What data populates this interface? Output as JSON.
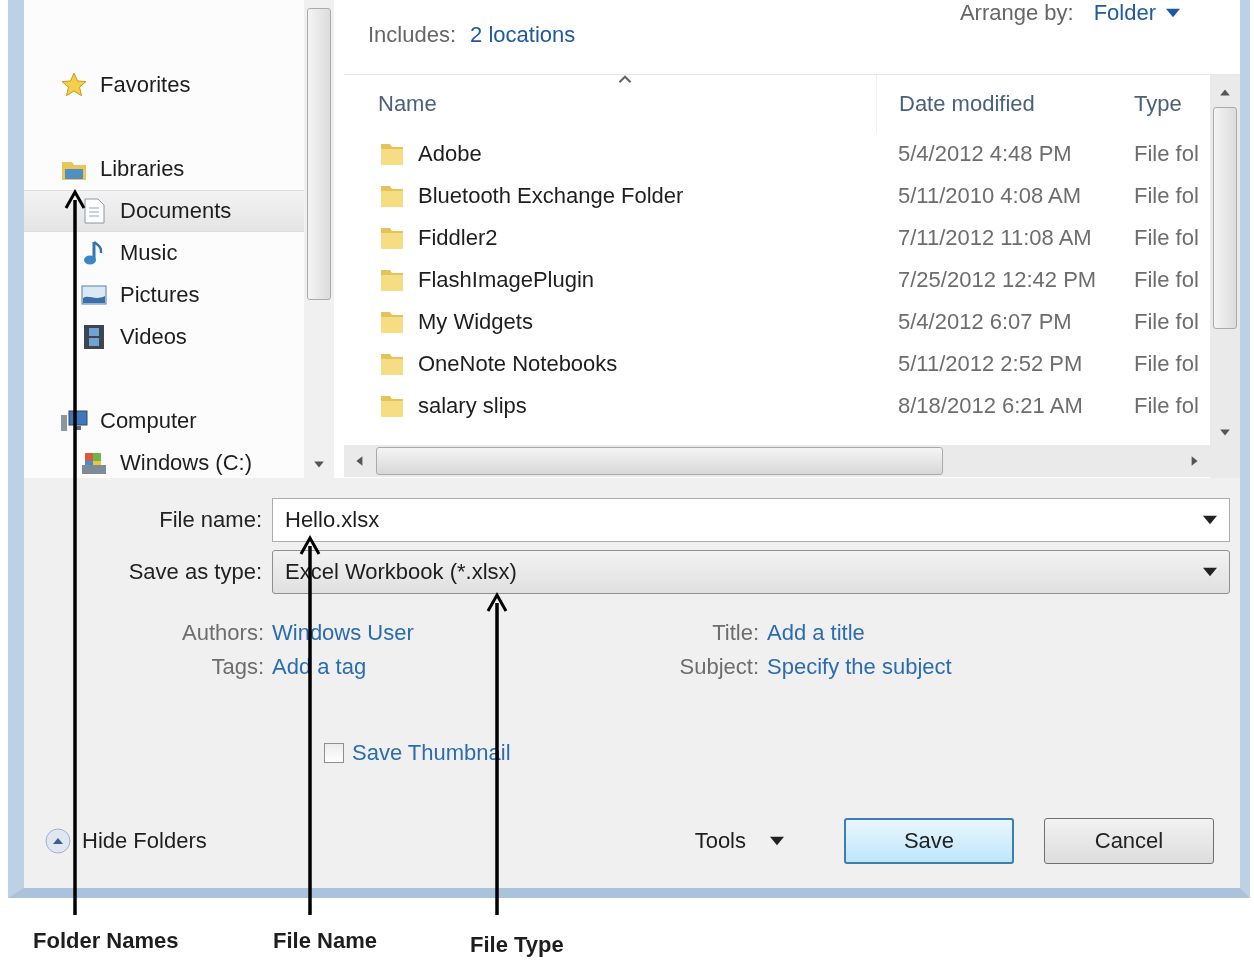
{
  "library_header": {
    "includes_label": "Includes:",
    "includes_value": "2 locations",
    "arrange_label": "Arrange by:",
    "arrange_value": "Folder"
  },
  "nav": [
    {
      "label": "Favorites",
      "kind": "favorites",
      "selected": false
    },
    {
      "label": "Libraries",
      "kind": "libraries",
      "selected": false,
      "children": [
        {
          "label": "Documents",
          "kind": "documents",
          "selected": true
        },
        {
          "label": "Music",
          "kind": "music",
          "selected": false
        },
        {
          "label": "Pictures",
          "kind": "pictures",
          "selected": false
        },
        {
          "label": "Videos",
          "kind": "videos",
          "selected": false
        }
      ]
    },
    {
      "label": "Computer",
      "kind": "computer",
      "selected": false,
      "children": [
        {
          "label": "Windows (C:)",
          "kind": "drive",
          "selected": false
        }
      ]
    }
  ],
  "table": {
    "columns": [
      "Name",
      "Date modified",
      "Type"
    ],
    "rows": [
      {
        "name": "Adobe",
        "date": "5/4/2012 4:48 PM",
        "type": "File fol"
      },
      {
        "name": "Bluetooth Exchange Folder",
        "date": "5/11/2010 4:08 AM",
        "type": "File fol"
      },
      {
        "name": "Fiddler2",
        "date": "7/11/2012 11:08 AM",
        "type": "File fol"
      },
      {
        "name": "FlashImagePlugin",
        "date": "7/25/2012 12:42 PM",
        "type": "File fol"
      },
      {
        "name": "My Widgets",
        "date": "5/4/2012 6:07 PM",
        "type": "File fol"
      },
      {
        "name": "OneNote Notebooks",
        "date": "5/11/2012 2:52 PM",
        "type": "File fol"
      },
      {
        "name": "salary slips",
        "date": "8/18/2012 6:21 AM",
        "type": "File fol"
      }
    ]
  },
  "file_name": {
    "label": "File name:",
    "value": "Hello.xlsx"
  },
  "save_as_type": {
    "label": "Save as type:",
    "value": "Excel Workbook (*.xlsx)"
  },
  "metadata": [
    {
      "label": "Authors:",
      "value": "Windows User"
    },
    {
      "label": "Title:",
      "value": "Add a title"
    },
    {
      "label": "Tags:",
      "value": "Add a tag"
    },
    {
      "label": "Subject:",
      "value": "Specify the subject"
    }
  ],
  "save_thumbnail": {
    "label": "Save Thumbnail",
    "checked": false
  },
  "hide_folders": "Hide Folders",
  "tools": "Tools",
  "buttons": [
    {
      "label": "Save",
      "default": true
    },
    {
      "label": "Cancel",
      "default": false
    }
  ],
  "annotations": [
    "Folder Names",
    "File Name",
    "File Type"
  ]
}
